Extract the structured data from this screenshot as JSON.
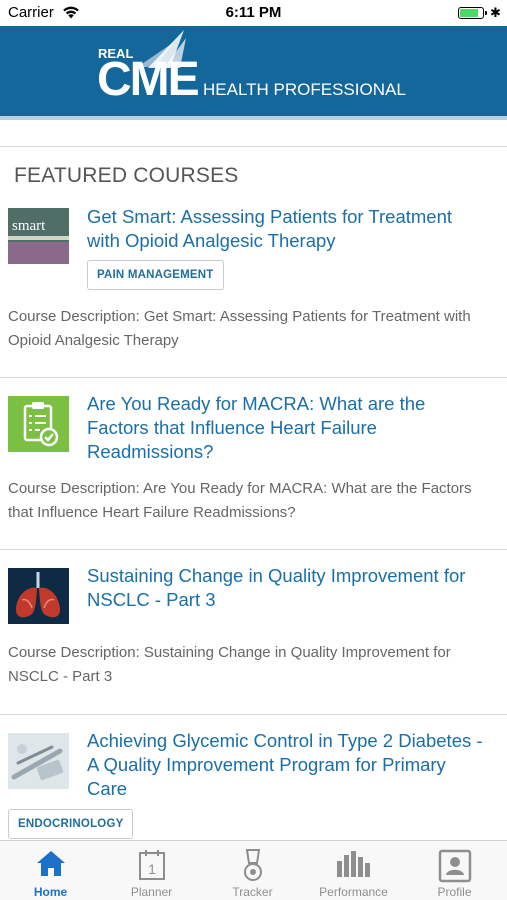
{
  "status": {
    "carrier": "Carrier",
    "time": "6:11 PM"
  },
  "header": {
    "logo_small": "REAL",
    "logo_big": "CME",
    "subtitle": "HEALTH PROFESSIONAL"
  },
  "section_title": "FEATURED COURSES",
  "courses": [
    {
      "title": "Get Smart: Assessing Patients for Treatment with Opioid Analgesic Therapy",
      "thumb_text": "smart",
      "tag": "PAIN MANAGEMENT",
      "description": "Course Description: Get Smart: Assessing Patients for Treatment with Opioid Analgesic Therapy"
    },
    {
      "title": "Are You Ready for MACRA: What are the Factors that Influence Heart Failure Readmissions?",
      "description": "Course Description: Are You Ready for MACRA: What are the Factors that Influence Heart Failure Readmissions?"
    },
    {
      "title": "Sustaining Change in Quality Improvement for NSCLC - Part 3",
      "description": "Course Description: Sustaining Change in Quality Improvement for NSCLC - Part 3"
    },
    {
      "title": "Achieving Glycemic Control in Type 2 Diabetes - A Quality Improvement Program for Primary Care",
      "tag": "ENDOCRINOLOGY"
    }
  ],
  "tabs": [
    {
      "label": "Home",
      "icon": "home-icon",
      "active": true
    },
    {
      "label": "Planner",
      "icon": "calendar-icon",
      "active": false
    },
    {
      "label": "Tracker",
      "icon": "medal-icon",
      "active": false
    },
    {
      "label": "Performance",
      "icon": "bar-chart-icon",
      "active": false
    },
    {
      "label": "Profile",
      "icon": "profile-card-icon",
      "active": false
    }
  ],
  "colors": {
    "header_bg": "#14679b",
    "link": "#1a6fa8",
    "tab_active": "#1a73c9",
    "battery": "#4cd964"
  }
}
